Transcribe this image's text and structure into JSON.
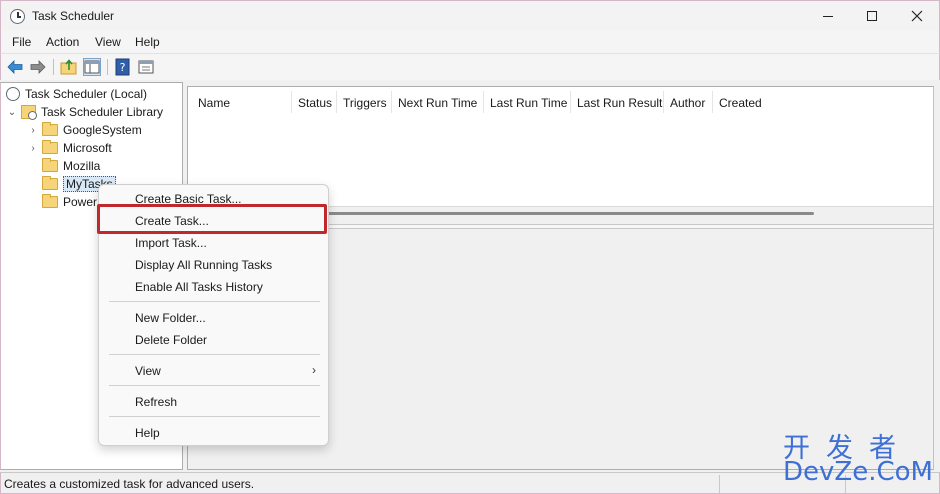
{
  "window": {
    "title": "Task Scheduler"
  },
  "menu": [
    "File",
    "Action",
    "View",
    "Help"
  ],
  "tree": {
    "root": "Task Scheduler (Local)",
    "library": "Task Scheduler Library",
    "folders": [
      "GoogleSystem",
      "Microsoft",
      "Mozilla",
      "MyTasks",
      "Power"
    ]
  },
  "columns": [
    "Name",
    "Status",
    "Triggers",
    "Next Run Time",
    "Last Run Time",
    "Last Run Result",
    "Author",
    "Created"
  ],
  "context_menu": {
    "items": [
      "Create Basic Task...",
      "Create Task...",
      "Import Task...",
      "Display All Running Tasks",
      "Enable All Tasks History",
      "New Folder...",
      "Delete Folder",
      "View",
      "Refresh",
      "Help"
    ],
    "highlighted": "Create Task...",
    "highlight_color": "#c0282d"
  },
  "status": "Creates a customized task for advanced users.",
  "watermark": {
    "cn": "开发者",
    "en": "DevZe.CoM",
    "color": "#3e6fd4"
  },
  "icons": [
    "clock-icon",
    "back-arrow-icon",
    "forward-arrow-icon",
    "folder-up-icon",
    "show-hide-tree-icon",
    "help-icon",
    "properties-icon",
    "folder-icon",
    "chevron-right-icon",
    "chevron-down-icon"
  ]
}
